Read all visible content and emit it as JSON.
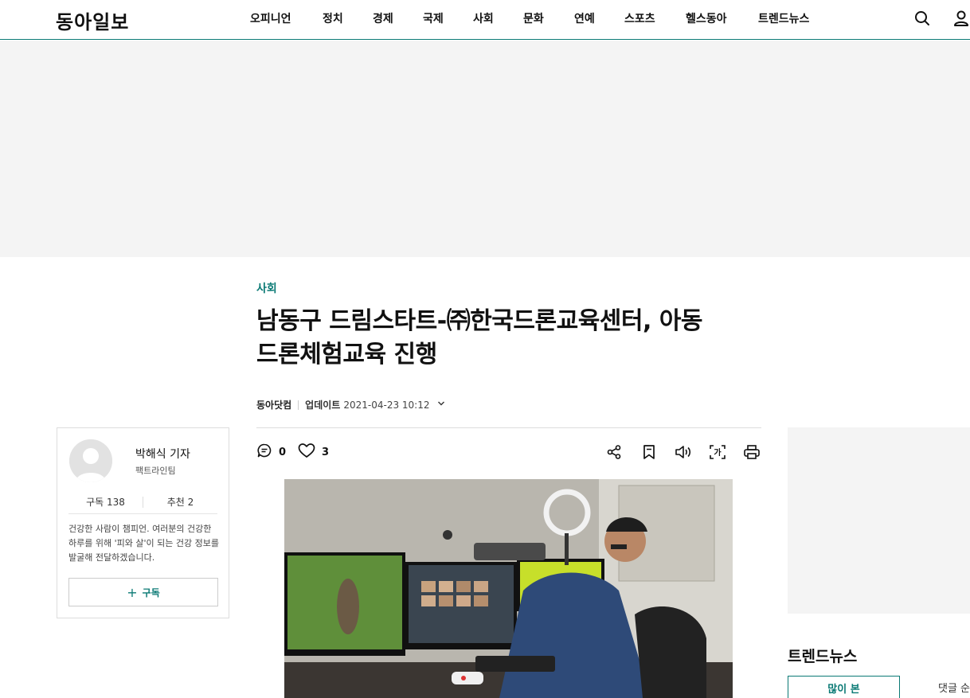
{
  "header": {
    "logo": "동아일보",
    "nav": [
      "오피니언",
      "정치",
      "경제",
      "국제",
      "사회",
      "문화",
      "연예",
      "스포츠",
      "헬스동아",
      "트렌드뉴스"
    ],
    "icons": {
      "search": "search-icon",
      "user": "user-icon"
    }
  },
  "article": {
    "section": "사회",
    "headline_line1": "남동구 드림스타트-㈜한국드론교육센터, 아동",
    "headline_line2": "드론체험교육 진행",
    "source": "동아닷컴",
    "updated_label": "업데이트",
    "updated_time": "2021-04-23 10:12",
    "comment_count": "0",
    "like_count": "3"
  },
  "reporter": {
    "name": "박해식 기자",
    "team": "팩트라인팀",
    "subscribers_label": "구독 138",
    "recommend_label": "추천 2",
    "description": "건강한 사람이 챔피언. 여러분의 건강한 하루를 위해 '피와 살'이 되는 건강 정보를 발굴해 전달하겠습니다.",
    "subscribe_button": "구독"
  },
  "sidebar": {
    "trend_title": "트렌드뉴스",
    "tabs": [
      "많이 본",
      "댓글 순"
    ]
  },
  "colors": {
    "accent": "#0b7a75",
    "ad_bg": "#f4f4f4"
  }
}
